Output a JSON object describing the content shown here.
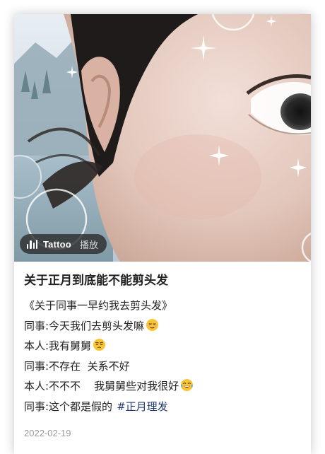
{
  "post": {
    "music_track": "Tattoo",
    "music_action": "播放",
    "title": "关于正月到底能不能剪头发",
    "lines": [
      {
        "text": "《关于同事一早约我去剪头发》"
      },
      {
        "text": "同事:今天我们去剪头发嘛",
        "emoji": "relieved-face-emoji"
      },
      {
        "text": "本人:我有舅舅",
        "emoji": "unamused-face-emoji"
      },
      {
        "text": "同事:不存在  关系不好"
      },
      {
        "text": "本人:不不不    我舅舅些对我很好",
        "emoji": "tears-of-joy-emoji"
      },
      {
        "text": "同事:这个都是假的",
        "hashtag": "#正月理发"
      }
    ],
    "date": "2022-02-19"
  },
  "colors": {
    "hashtag": "#1f3a6e",
    "date": "#9a9a9a",
    "pill_bg": "#282828"
  }
}
